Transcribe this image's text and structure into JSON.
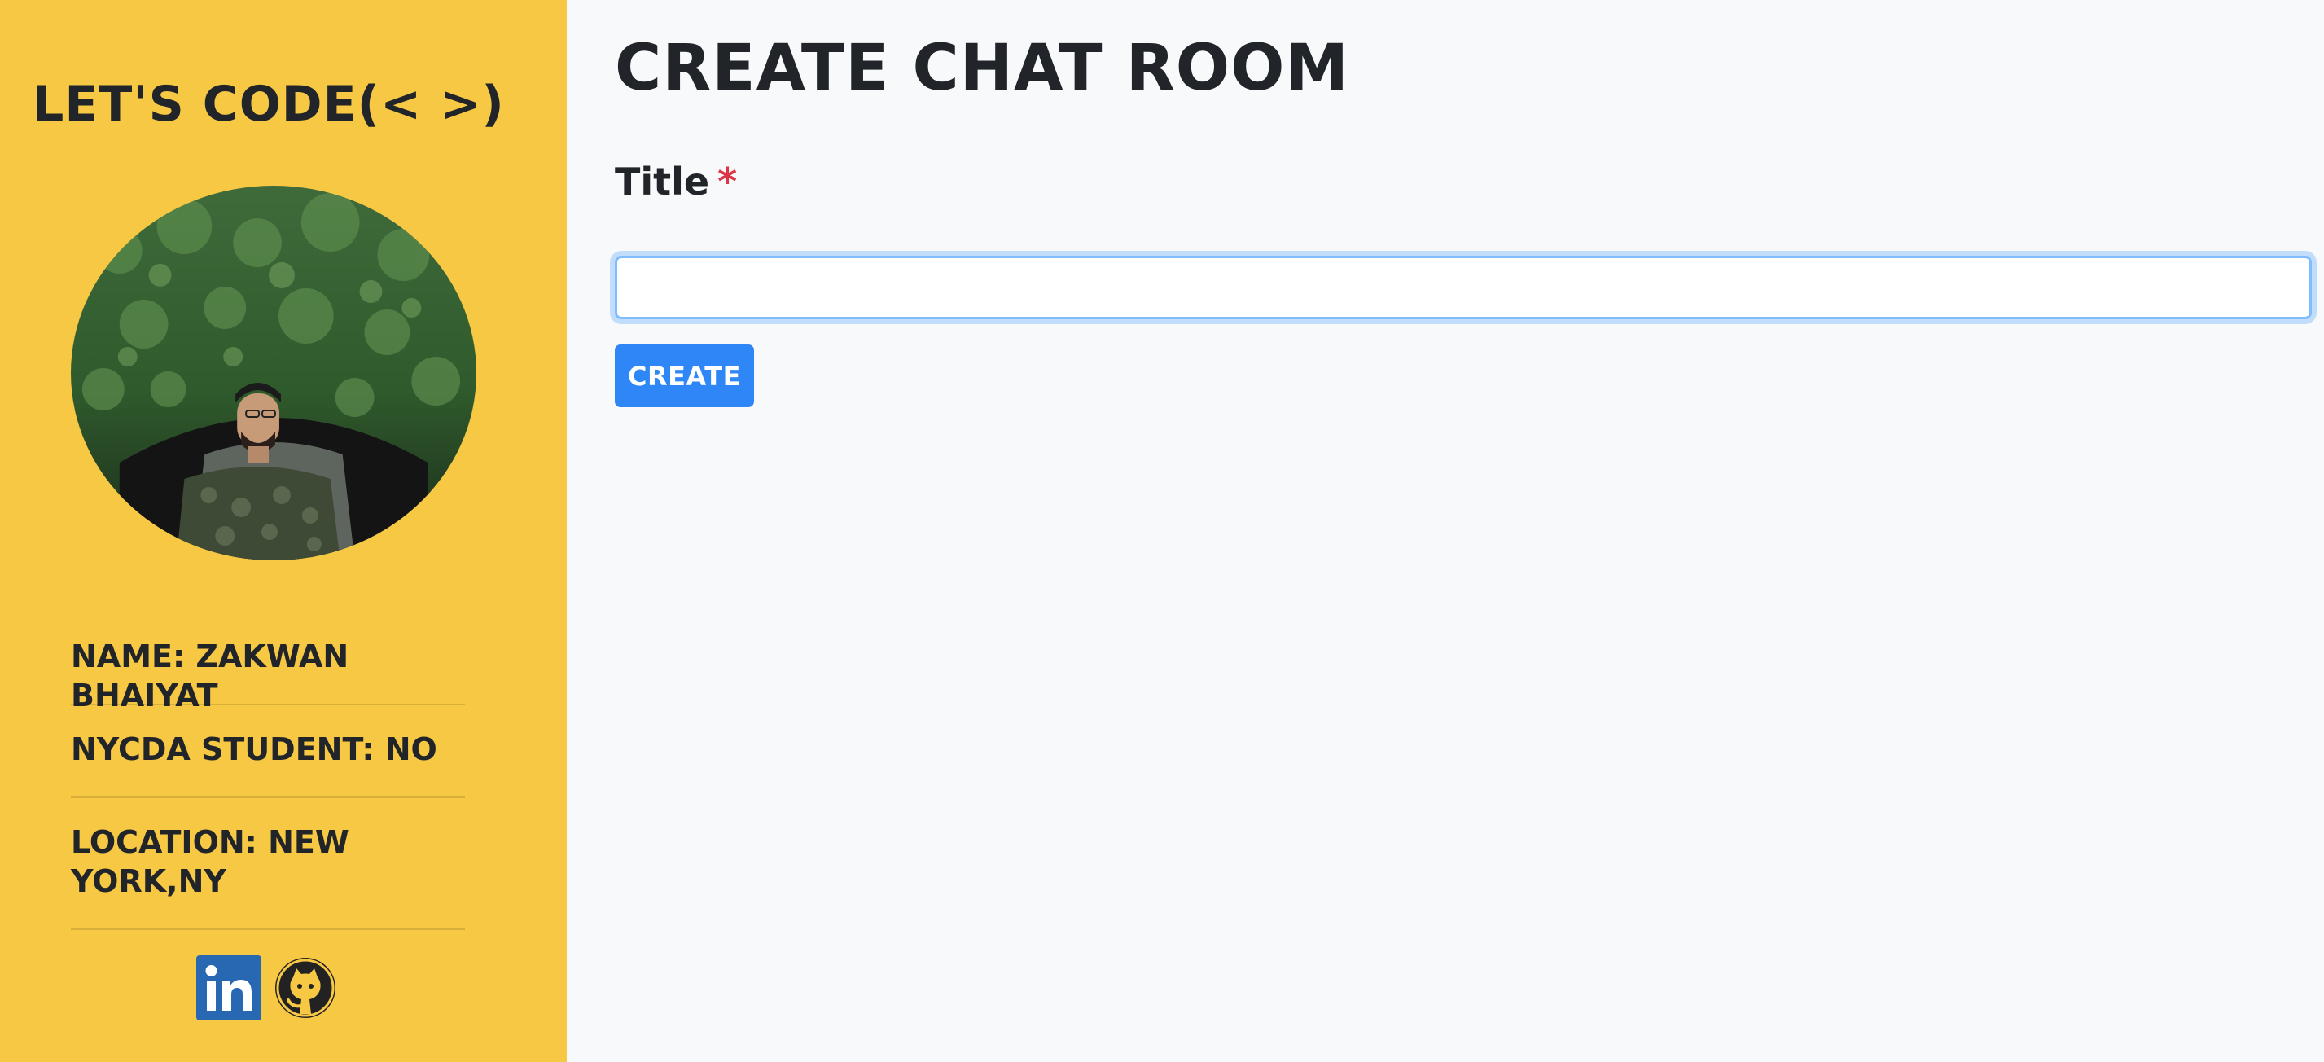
{
  "sidebar": {
    "brand": "LET'S CODE(< >)",
    "name": "NAME: ZAKWAN BHAIYAT",
    "student": "NYCDA STUDENT: NO",
    "location": "LOCATION: NEW YORK,NY",
    "social": [
      {
        "icon": "linkedin-icon",
        "label": "in",
        "color": "#2867b2"
      },
      {
        "icon": "github-icon",
        "color": "#222222"
      }
    ]
  },
  "main": {
    "title": "CREATE CHAT ROOM",
    "form": {
      "title_label": "Title",
      "required_mark": "*",
      "title_value": "",
      "create_label": "CREATE"
    }
  },
  "colors": {
    "sidebar_bg": "#f7c844",
    "page_bg": "#f8f9fa",
    "primary": "#2f86f6",
    "required": "#dc3545"
  }
}
